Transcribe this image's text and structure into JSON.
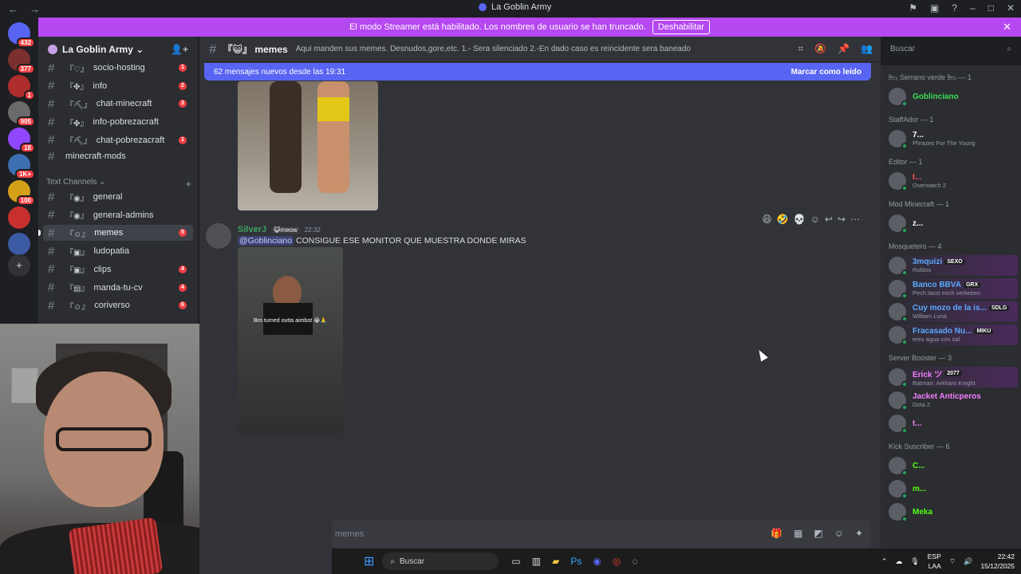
{
  "window": {
    "title": "La Goblin Army",
    "back": "←",
    "forward": "→"
  },
  "streamer_banner": {
    "text": "El modo Streamer está habilitado. Los nombres de usuario se han truncado.",
    "button": "Deshabilitar",
    "close": "✕"
  },
  "guilds": [
    {
      "badge": "432",
      "color": "#5865f2"
    },
    {
      "badge": "377",
      "color": "#7b2f2f"
    },
    {
      "badge": "1",
      "color": "#b02d2d"
    },
    {
      "badge": "905",
      "color": "#6a6a6a"
    },
    {
      "badge": "18",
      "color": "#9146ff"
    },
    {
      "badge": "1K+",
      "color": "#3b6fb0"
    },
    {
      "badge": "100",
      "color": "#d4a017"
    },
    {
      "badge": "",
      "color": "#c8302e"
    },
    {
      "badge": "",
      "color": "#3b5ba5"
    }
  ],
  "server": {
    "name": "La Goblin Army ⌄"
  },
  "channels_top": [
    {
      "emoji": "『♡』",
      "name": "socio-hosting",
      "count": "1"
    },
    {
      "emoji": "『✤』",
      "name": "info",
      "count": "2"
    },
    {
      "emoji": "『⛏』",
      "name": "chat-minecraft",
      "count": "3"
    },
    {
      "emoji": "『✤』",
      "name": "info-pobrezacraft",
      "count": ""
    },
    {
      "emoji": "『⛏』",
      "name": "chat-pobrezacraft",
      "count": "1"
    }
  ],
  "channel_plain": {
    "name": "minecraft-mods"
  },
  "text_category": {
    "label": "Text Channels ⌄",
    "plus": "+"
  },
  "channels_text": [
    {
      "emoji": "『◉』",
      "name": "general",
      "count": ""
    },
    {
      "emoji": "『◉』",
      "name": "general-admins",
      "count": ""
    },
    {
      "emoji": "『☺』",
      "name": "memes",
      "count": "5",
      "active": true
    },
    {
      "emoji": "『▣』",
      "name": "ludopatia",
      "count": ""
    },
    {
      "emoji": "『▣』",
      "name": "clips",
      "count": "4"
    },
    {
      "emoji": "『▤』",
      "name": "manda-tu-cv",
      "count": "4"
    },
    {
      "emoji": "『☺』",
      "name": "coriverso",
      "count": "6"
    }
  ],
  "topbar": {
    "channel": "『😺』 memes",
    "topic": "Aqui manden sus memes. Desnudos,gore,etc. 1.- Sera silenciado 2.-En dado caso es reincidente sera baneado"
  },
  "newbar": {
    "text": "62 mensajes nuevos desde las 19:31",
    "mark": "Marcar como leído"
  },
  "message": {
    "author": "SilverJ",
    "tag": "😺meow",
    "time": "22:32",
    "mention": "@Goblinciano",
    "text": " CONSIGUE  ESE MONITOR QUE MUESTRA DONDE MIRAS",
    "image_caption": "Bro turned outta aimbot 😭🙏"
  },
  "composer": {
    "placeholder": "memes"
  },
  "search": {
    "placeholder": "Buscar"
  },
  "members": {
    "groups": [
      {
        "label": "🛏 Serrano verde 🛏 — 1",
        "members": [
          {
            "name": "Goblinciano",
            "sub": "",
            "color": "#3ddc54",
            "tag": ""
          }
        ]
      },
      {
        "label": "StaffAdor — 1",
        "members": [
          {
            "name": "7...",
            "sub": "Phrazes For The Young",
            "color": "#ffffff",
            "tag": ""
          }
        ]
      },
      {
        "label": "Editor — 1",
        "members": [
          {
            "name": "I...",
            "sub": "Overwatch 2",
            "color": "#ff5555",
            "tag": ""
          }
        ]
      },
      {
        "label": "Mod Minecraft — 1",
        "members": [
          {
            "name": "z...",
            "sub": "",
            "color": "#ffffff",
            "tag": ""
          }
        ]
      },
      {
        "label": "Mosquetero — 4",
        "members": [
          {
            "name": "3mquizi",
            "sub": "Roblox",
            "color": "#5aa9ff",
            "tag": "SEXO"
          },
          {
            "name": "Banco BBVA",
            "sub": "Pech lässt mich verlieben",
            "color": "#5aa9ff",
            "tag": "GRX"
          },
          {
            "name": "Cuy mozo de la is...",
            "sub": "William Luna",
            "color": "#5aa9ff",
            "tag": "SDLG"
          },
          {
            "name": "Fracasado Nu...",
            "sub": "eres agua con sal",
            "color": "#5aa9ff",
            "tag": "MIKU"
          }
        ]
      },
      {
        "label": "Server Booster — 3",
        "members": [
          {
            "name": "Erick ツ",
            "sub": "Batman: Arkham Knight",
            "color": "#f47fff",
            "tag": "2077"
          },
          {
            "name": "Jacket Anticperos",
            "sub": "Dota 2",
            "color": "#f47fff",
            "tag": ""
          },
          {
            "name": "t...",
            "sub": "",
            "color": "#f47fff",
            "tag": ""
          }
        ]
      },
      {
        "label": "Kick Suscriber — 6",
        "members": [
          {
            "name": "C...",
            "sub": "",
            "color": "#53fc18",
            "tag": ""
          },
          {
            "name": "m...",
            "sub": "",
            "color": "#53fc18",
            "tag": ""
          },
          {
            "name": "Meka",
            "sub": "",
            "color": "#53fc18",
            "tag": ""
          }
        ]
      }
    ]
  },
  "taskbar": {
    "search": "Buscar",
    "lang": "ESP",
    "lang2": "LAA",
    "time": "22:42",
    "date": "15/12/2025"
  }
}
